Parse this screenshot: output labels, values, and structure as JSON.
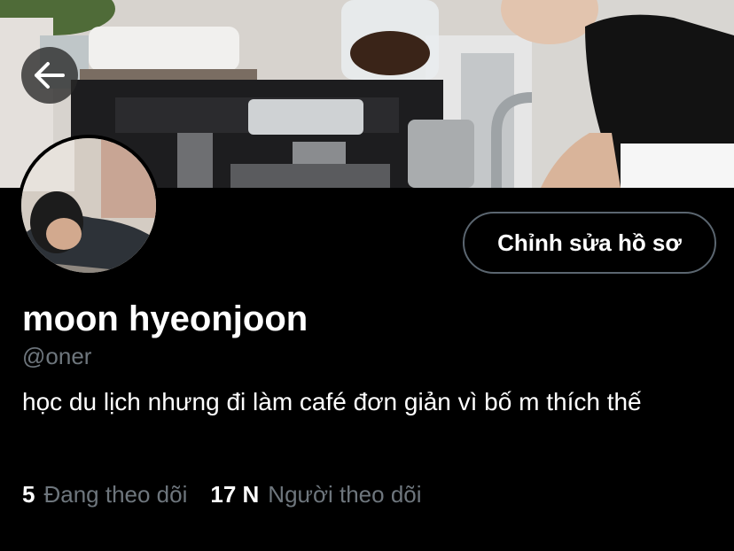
{
  "header": {
    "banner_name": "cafe-banner",
    "back_icon": "arrow-left-icon"
  },
  "profile": {
    "edit_button_label": "Chỉnh sửa hồ sơ",
    "display_name": "moon hyeonjoon",
    "handle": "@oner",
    "bio": "học du lịch nhưng đi làm café đơn giản vì bố m thích thế"
  },
  "stats": {
    "following_count": "5",
    "following_label": "Đang theo dõi",
    "followers_count": "17 N",
    "followers_label": "Người theo dõi"
  },
  "colors": {
    "background": "#000000",
    "muted_text": "#6e767d",
    "button_border": "#5b6670"
  }
}
